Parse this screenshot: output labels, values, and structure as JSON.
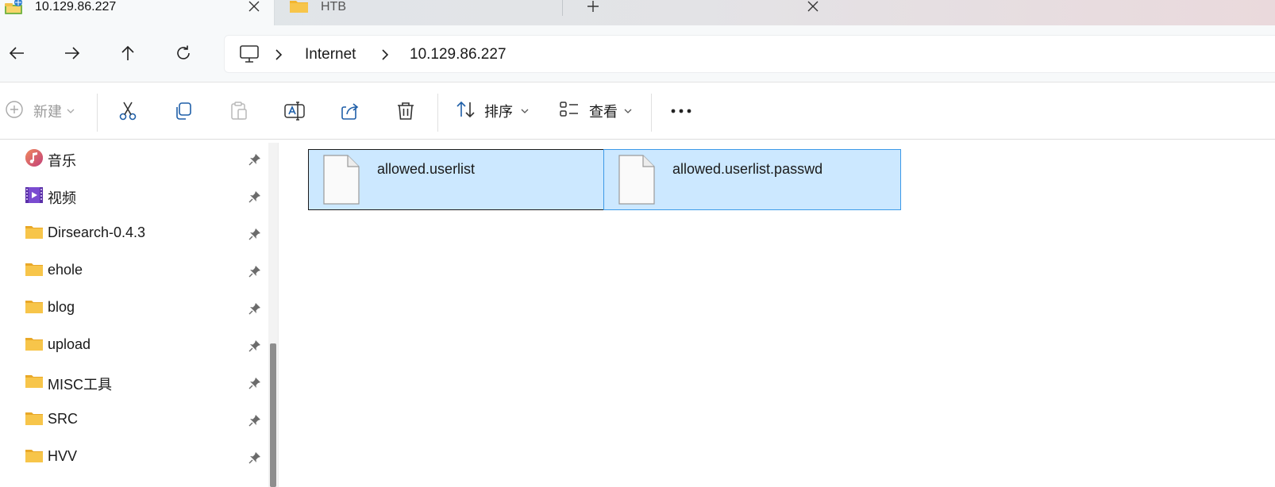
{
  "tabs": [
    {
      "title": "10.129.86.227",
      "active": true,
      "icon": "network-folder-icon"
    },
    {
      "title": "HTB",
      "active": false,
      "icon": "folder-icon"
    }
  ],
  "breadcrumb": [
    "Internet",
    "10.129.86.227"
  ],
  "toolbar": {
    "new_label": "新建",
    "sort_label": "排序",
    "view_label": "查看"
  },
  "sidebar": {
    "items": [
      {
        "label": "音乐",
        "icon": "music-icon"
      },
      {
        "label": "视频",
        "icon": "video-icon"
      },
      {
        "label": "Dirsearch-0.4.3",
        "icon": "folder-icon"
      },
      {
        "label": "ehole",
        "icon": "folder-icon"
      },
      {
        "label": "blog",
        "icon": "folder-icon"
      },
      {
        "label": "upload",
        "icon": "folder-icon"
      },
      {
        "label": "MISC工具",
        "icon": "folder-icon"
      },
      {
        "label": "SRC",
        "icon": "folder-icon"
      },
      {
        "label": "HVV",
        "icon": "folder-icon"
      }
    ]
  },
  "files": [
    {
      "name": "allowed.userlist",
      "state": "selected-focused"
    },
    {
      "name": "allowed.userlist.passwd",
      "state": "selected"
    }
  ],
  "colors": {
    "selection": "#cce8ff",
    "selection_border": "#3d9ae8",
    "folder": "#f7c54a",
    "accent": "#0067c0"
  }
}
